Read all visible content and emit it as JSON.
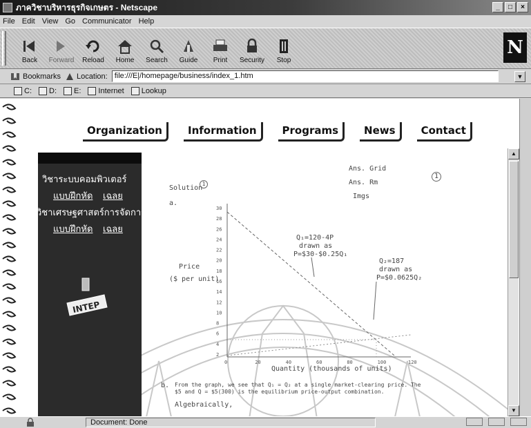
{
  "window": {
    "title": "ภาควิชาบริหารธุรกิจเกษตร - Netscape",
    "controls": [
      "_",
      "□",
      "×"
    ]
  },
  "menu": [
    {
      "label": "File"
    },
    {
      "label": "Edit"
    },
    {
      "label": "View"
    },
    {
      "label": "Go"
    },
    {
      "label": "Communicator"
    },
    {
      "label": "Help"
    }
  ],
  "toolbar": {
    "buttons": [
      {
        "label": "Back",
        "icon": "back-arrow-icon"
      },
      {
        "label": "Forward",
        "icon": "forward-arrow-icon"
      },
      {
        "label": "Reload",
        "icon": "reload-icon"
      },
      {
        "label": "Home",
        "icon": "home-icon"
      },
      {
        "label": "Search",
        "icon": "search-icon"
      },
      {
        "label": "Guide",
        "icon": "guide-icon"
      },
      {
        "label": "Print",
        "icon": "print-icon"
      },
      {
        "label": "Security",
        "icon": "lock-icon"
      },
      {
        "label": "Stop",
        "icon": "stop-icon"
      }
    ],
    "logo": "N"
  },
  "location": {
    "bookmarks_label": "Bookmarks",
    "location_label": "Location:",
    "url": "file:///E|/homepage/business/index_1.htm"
  },
  "personal_toolbar": [
    {
      "label": "C:"
    },
    {
      "label": "D:"
    },
    {
      "label": "E:"
    },
    {
      "label": "Internet"
    },
    {
      "label": "Lookup"
    }
  ],
  "page": {
    "nav": [
      {
        "label": "Organization"
      },
      {
        "label": "Information"
      },
      {
        "label": "Programs"
      },
      {
        "label": "News"
      },
      {
        "label": "Contact"
      }
    ],
    "sidebar": {
      "course1": "วิชาระบบคอมพิวเตอร์",
      "course1_exercise": "แบบฝึกหัด",
      "course1_answer": "เฉลย",
      "course2": "วิชาเศรษฐศาสตร์การจัดการ",
      "course2_exercise": "แบบฝึกหัด",
      "course2_answer": "เฉลย",
      "logo_text": "INTEP"
    },
    "doc": {
      "solution_label": "Solution",
      "solution_number": "1",
      "header_line1": "Ans. Grid",
      "header_line2": "Ans. Rm",
      "header_line3": "Imgs",
      "page_number": "1",
      "part_a": "a.",
      "annot1": "Q₁=120-4P",
      "annot1b": "drawn as",
      "annot1c": "P=$30-$0.25Q₁",
      "annot2": "Q₂=187",
      "annot2b": "drawn as",
      "annot2c": "P=$0.0625Q₂",
      "price_label": "Price",
      "price_unit": "($ per unit)",
      "x_axis_label": "Quantity (thousands of units)",
      "x_ticks": [
        "0",
        "20",
        "40",
        "60",
        "80",
        "100",
        "120"
      ],
      "y_ticks": [
        "30",
        "28",
        "26",
        "24",
        "22",
        "20",
        "18",
        "16",
        "14",
        "12",
        "10",
        "8",
        "6",
        "4",
        "2"
      ],
      "part_b_text": "From the graph, we see that Q₁ = Q₂ at a single market-clearing price. The $5 and Q = $5(300) is the equilibrium price-output combination.",
      "part_b_label": "b.",
      "algebraically": "Algebraically,"
    }
  },
  "status": {
    "text": "Document: Done"
  }
}
